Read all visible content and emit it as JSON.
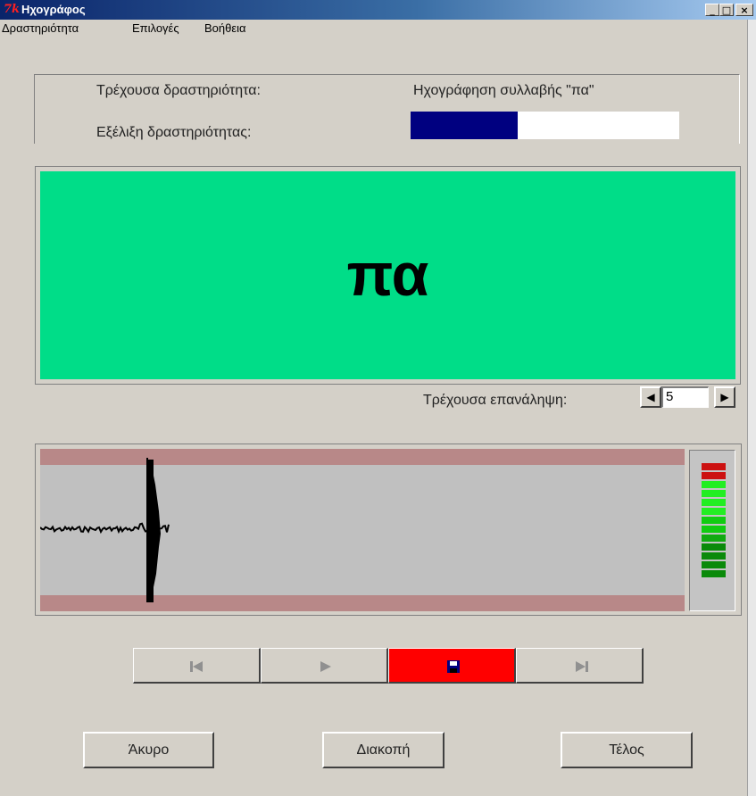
{
  "window": {
    "title": "Ηχογράφος",
    "icon_glyph": "7k",
    "minimize": "_",
    "maximize": "□",
    "close": "×"
  },
  "menu": [
    {
      "label": "Δραστηριότητα"
    },
    {
      "label": "Επιλογές"
    },
    {
      "label": "Βοήθεια"
    }
  ],
  "status": {
    "activity_label": "Τρέχουσα δραστηριότητα:",
    "activity_value": "Ηχογράφηση συλλαβής \"πα\"",
    "progress_label": "Εξέλιξη δραστηριότητας:",
    "progress_fraction": 0.4,
    "progress_color": "#000080"
  },
  "syllable": {
    "text": "πα",
    "background_color": "#00dd88"
  },
  "repetition": {
    "label": "Τρέχουσα επανάληψη:",
    "value": "5",
    "decrement_icon": "triangle-left-icon",
    "increment_icon": "triangle-right-icon"
  },
  "vu_meter": {
    "segments": [
      "#cc1111",
      "#cc1111",
      "#22ee22",
      "#22ee22",
      "#22ee22",
      "#22ee22",
      "#11cc11",
      "#11cc11",
      "#11aa11",
      "#0a8a0a",
      "#0a8a0a",
      "#0a8a0a",
      "#0a8a0a"
    ]
  },
  "transport": [
    {
      "name": "first-button",
      "icon": "skip-back-icon",
      "enabled": false
    },
    {
      "name": "play-button",
      "icon": "play-icon",
      "enabled": false
    },
    {
      "name": "record-save-button",
      "icon": "floppy-disk-icon",
      "enabled": true,
      "bg": "#ff0000"
    },
    {
      "name": "last-button",
      "icon": "skip-forward-icon",
      "enabled": false
    }
  ],
  "buttons": {
    "cancel": "Άκυρο",
    "stop": "Διακοπή",
    "finish": "Τέλος"
  },
  "colors": {
    "window_bg": "#d4d0c8",
    "wave_band": "#b88888",
    "wave_bg": "#c0c0c0"
  }
}
